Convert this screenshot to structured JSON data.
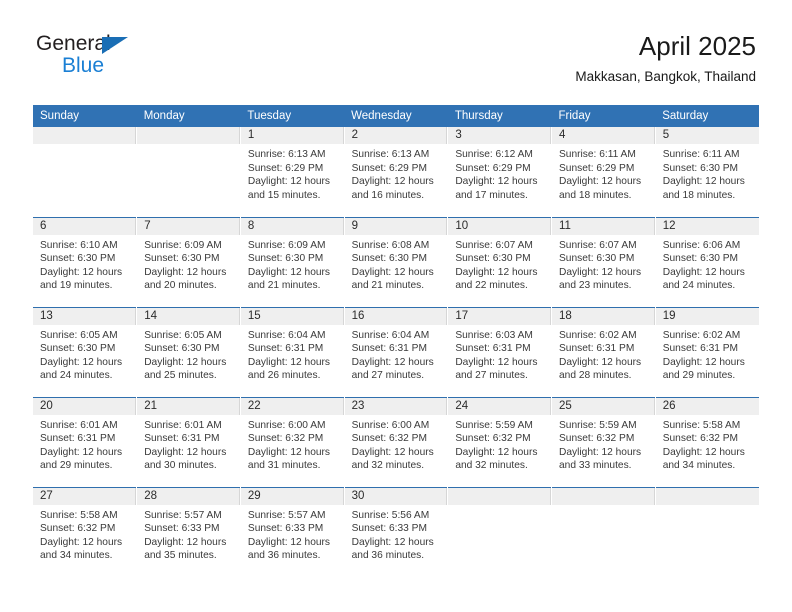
{
  "brand": {
    "name_top": "General",
    "name_bottom": "Blue",
    "triangle_color": "#1a6eb5",
    "blue_text_color": "#1a7fd4"
  },
  "header": {
    "title": "April 2025",
    "subtitle": "Makkasan, Bangkok, Thailand"
  },
  "theme": {
    "header_blue": "#3072b4",
    "week_divider": "#2f6fae",
    "daynum_band": "#efefef"
  },
  "weekdays": [
    "Sunday",
    "Monday",
    "Tuesday",
    "Wednesday",
    "Thursday",
    "Friday",
    "Saturday"
  ],
  "weeks": [
    [
      {
        "day": ""
      },
      {
        "day": ""
      },
      {
        "day": "1",
        "sunrise": "Sunrise: 6:13 AM",
        "sunset": "Sunset: 6:29 PM",
        "daylight": "Daylight: 12 hours and 15 minutes."
      },
      {
        "day": "2",
        "sunrise": "Sunrise: 6:13 AM",
        "sunset": "Sunset: 6:29 PM",
        "daylight": "Daylight: 12 hours and 16 minutes."
      },
      {
        "day": "3",
        "sunrise": "Sunrise: 6:12 AM",
        "sunset": "Sunset: 6:29 PM",
        "daylight": "Daylight: 12 hours and 17 minutes."
      },
      {
        "day": "4",
        "sunrise": "Sunrise: 6:11 AM",
        "sunset": "Sunset: 6:29 PM",
        "daylight": "Daylight: 12 hours and 18 minutes."
      },
      {
        "day": "5",
        "sunrise": "Sunrise: 6:11 AM",
        "sunset": "Sunset: 6:30 PM",
        "daylight": "Daylight: 12 hours and 18 minutes."
      }
    ],
    [
      {
        "day": "6",
        "sunrise": "Sunrise: 6:10 AM",
        "sunset": "Sunset: 6:30 PM",
        "daylight": "Daylight: 12 hours and 19 minutes."
      },
      {
        "day": "7",
        "sunrise": "Sunrise: 6:09 AM",
        "sunset": "Sunset: 6:30 PM",
        "daylight": "Daylight: 12 hours and 20 minutes."
      },
      {
        "day": "8",
        "sunrise": "Sunrise: 6:09 AM",
        "sunset": "Sunset: 6:30 PM",
        "daylight": "Daylight: 12 hours and 21 minutes."
      },
      {
        "day": "9",
        "sunrise": "Sunrise: 6:08 AM",
        "sunset": "Sunset: 6:30 PM",
        "daylight": "Daylight: 12 hours and 21 minutes."
      },
      {
        "day": "10",
        "sunrise": "Sunrise: 6:07 AM",
        "sunset": "Sunset: 6:30 PM",
        "daylight": "Daylight: 12 hours and 22 minutes."
      },
      {
        "day": "11",
        "sunrise": "Sunrise: 6:07 AM",
        "sunset": "Sunset: 6:30 PM",
        "daylight": "Daylight: 12 hours and 23 minutes."
      },
      {
        "day": "12",
        "sunrise": "Sunrise: 6:06 AM",
        "sunset": "Sunset: 6:30 PM",
        "daylight": "Daylight: 12 hours and 24 minutes."
      }
    ],
    [
      {
        "day": "13",
        "sunrise": "Sunrise: 6:05 AM",
        "sunset": "Sunset: 6:30 PM",
        "daylight": "Daylight: 12 hours and 24 minutes."
      },
      {
        "day": "14",
        "sunrise": "Sunrise: 6:05 AM",
        "sunset": "Sunset: 6:30 PM",
        "daylight": "Daylight: 12 hours and 25 minutes."
      },
      {
        "day": "15",
        "sunrise": "Sunrise: 6:04 AM",
        "sunset": "Sunset: 6:31 PM",
        "daylight": "Daylight: 12 hours and 26 minutes."
      },
      {
        "day": "16",
        "sunrise": "Sunrise: 6:04 AM",
        "sunset": "Sunset: 6:31 PM",
        "daylight": "Daylight: 12 hours and 27 minutes."
      },
      {
        "day": "17",
        "sunrise": "Sunrise: 6:03 AM",
        "sunset": "Sunset: 6:31 PM",
        "daylight": "Daylight: 12 hours and 27 minutes."
      },
      {
        "day": "18",
        "sunrise": "Sunrise: 6:02 AM",
        "sunset": "Sunset: 6:31 PM",
        "daylight": "Daylight: 12 hours and 28 minutes."
      },
      {
        "day": "19",
        "sunrise": "Sunrise: 6:02 AM",
        "sunset": "Sunset: 6:31 PM",
        "daylight": "Daylight: 12 hours and 29 minutes."
      }
    ],
    [
      {
        "day": "20",
        "sunrise": "Sunrise: 6:01 AM",
        "sunset": "Sunset: 6:31 PM",
        "daylight": "Daylight: 12 hours and 29 minutes."
      },
      {
        "day": "21",
        "sunrise": "Sunrise: 6:01 AM",
        "sunset": "Sunset: 6:31 PM",
        "daylight": "Daylight: 12 hours and 30 minutes."
      },
      {
        "day": "22",
        "sunrise": "Sunrise: 6:00 AM",
        "sunset": "Sunset: 6:32 PM",
        "daylight": "Daylight: 12 hours and 31 minutes."
      },
      {
        "day": "23",
        "sunrise": "Sunrise: 6:00 AM",
        "sunset": "Sunset: 6:32 PM",
        "daylight": "Daylight: 12 hours and 32 minutes."
      },
      {
        "day": "24",
        "sunrise": "Sunrise: 5:59 AM",
        "sunset": "Sunset: 6:32 PM",
        "daylight": "Daylight: 12 hours and 32 minutes."
      },
      {
        "day": "25",
        "sunrise": "Sunrise: 5:59 AM",
        "sunset": "Sunset: 6:32 PM",
        "daylight": "Daylight: 12 hours and 33 minutes."
      },
      {
        "day": "26",
        "sunrise": "Sunrise: 5:58 AM",
        "sunset": "Sunset: 6:32 PM",
        "daylight": "Daylight: 12 hours and 34 minutes."
      }
    ],
    [
      {
        "day": "27",
        "sunrise": "Sunrise: 5:58 AM",
        "sunset": "Sunset: 6:32 PM",
        "daylight": "Daylight: 12 hours and 34 minutes."
      },
      {
        "day": "28",
        "sunrise": "Sunrise: 5:57 AM",
        "sunset": "Sunset: 6:33 PM",
        "daylight": "Daylight: 12 hours and 35 minutes."
      },
      {
        "day": "29",
        "sunrise": "Sunrise: 5:57 AM",
        "sunset": "Sunset: 6:33 PM",
        "daylight": "Daylight: 12 hours and 36 minutes."
      },
      {
        "day": "30",
        "sunrise": "Sunrise: 5:56 AM",
        "sunset": "Sunset: 6:33 PM",
        "daylight": "Daylight: 12 hours and 36 minutes."
      },
      {
        "day": ""
      },
      {
        "day": ""
      },
      {
        "day": ""
      }
    ]
  ]
}
